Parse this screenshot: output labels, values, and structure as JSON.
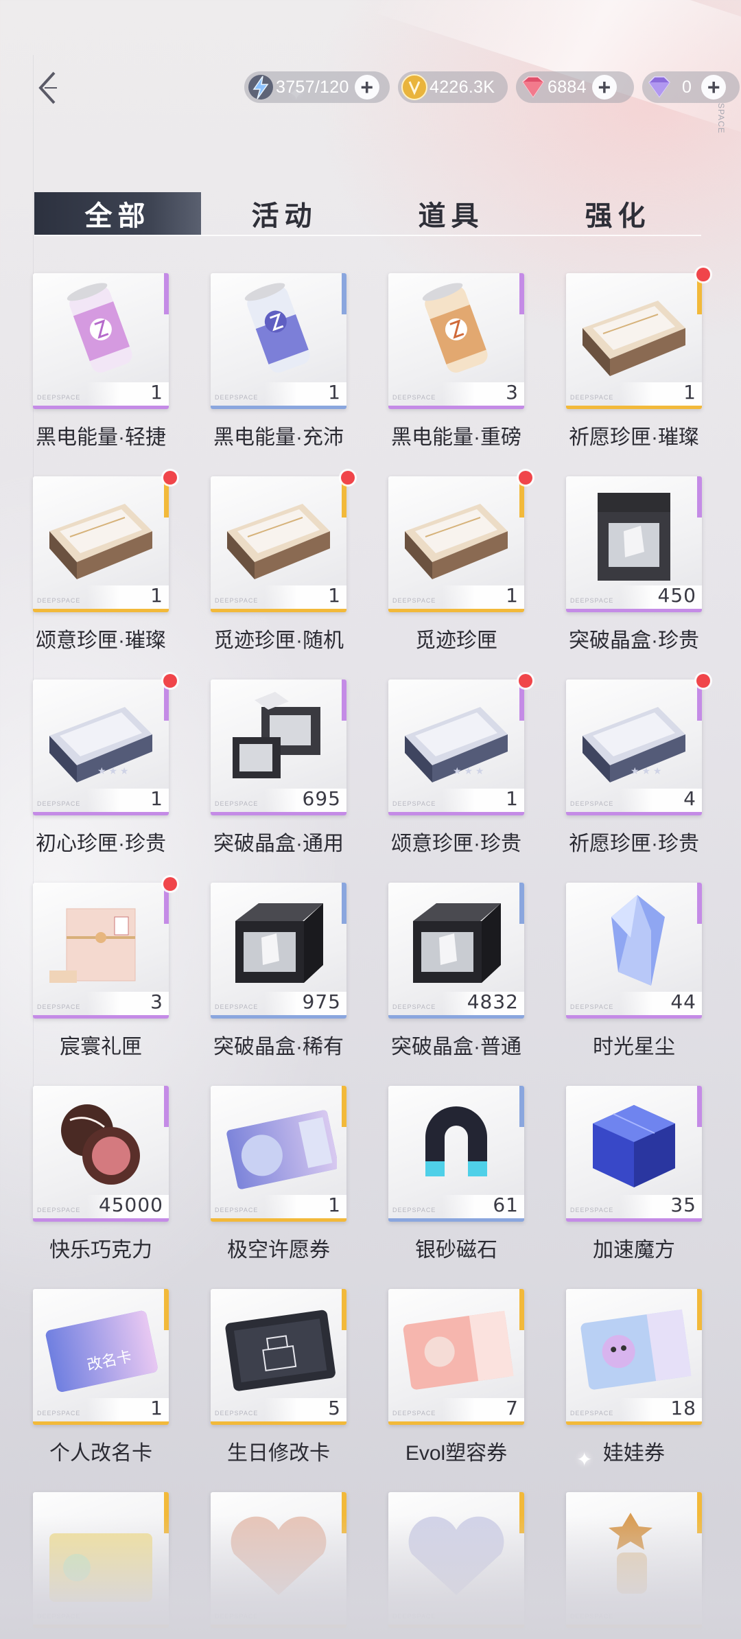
{
  "topbar": {
    "back_icon": "chevron-left-icon",
    "resources": [
      {
        "icon": "lightning-icon",
        "value": "3757/120",
        "color": "#6fa3e8"
      },
      {
        "icon": "gold-coin-icon",
        "value": "4226.3K",
        "color": "#e9b43c"
      },
      {
        "icon": "red-gem-icon",
        "value": "6884",
        "color": "#e0506a"
      },
      {
        "icon": "purple-diamond-icon",
        "value": "0",
        "color": "#8c6cdc"
      }
    ]
  },
  "tabs": [
    {
      "label": "全部",
      "active": true
    },
    {
      "label": "活动",
      "active": false
    },
    {
      "label": "道具",
      "active": false
    },
    {
      "label": "强化",
      "active": false
    }
  ],
  "colors": {
    "rarity_gold": "#f2b93a",
    "rarity_purple": "#c48be6",
    "rarity_blue": "#8aa6de",
    "notify_red": "#f0454a"
  },
  "items": [
    {
      "name": "黑电能量·轻捷",
      "count": "1",
      "rarity": "purple",
      "art": "can-purple",
      "dot": false
    },
    {
      "name": "黑电能量·充沛",
      "count": "1",
      "rarity": "blue",
      "art": "can-blue",
      "dot": false
    },
    {
      "name": "黑电能量·重磅",
      "count": "3",
      "rarity": "purple",
      "art": "can-gold",
      "dot": false
    },
    {
      "name": "祈愿珍匣·璀璨",
      "count": "1",
      "rarity": "gold",
      "art": "box-gold",
      "dot": true
    },
    {
      "name": "颂意珍匣·璀璨",
      "count": "1",
      "rarity": "gold",
      "art": "box-gold",
      "dot": true
    },
    {
      "name": "觅迹珍匣·随机",
      "count": "1",
      "rarity": "gold",
      "art": "box-gold",
      "dot": true
    },
    {
      "name": "觅迹珍匣",
      "count": "1",
      "rarity": "gold",
      "art": "box-gold",
      "dot": true
    },
    {
      "name": "突破晶盒·珍贵",
      "count": "450",
      "rarity": "purple",
      "art": "crate-dark",
      "dot": false
    },
    {
      "name": "初心珍匣·珍贵",
      "count": "1",
      "rarity": "purple",
      "art": "box-blue",
      "dot": true
    },
    {
      "name": "突破晶盒·通用",
      "count": "695",
      "rarity": "purple",
      "art": "crates-open",
      "dot": false
    },
    {
      "name": "颂意珍匣·珍贵",
      "count": "1",
      "rarity": "purple",
      "art": "box-blue",
      "dot": true
    },
    {
      "name": "祈愿珍匣·珍贵",
      "count": "4",
      "rarity": "purple",
      "art": "box-blue",
      "dot": true
    },
    {
      "name": "宸寰礼匣",
      "count": "3",
      "rarity": "purple",
      "art": "gift-box",
      "dot": true
    },
    {
      "name": "突破晶盒·稀有",
      "count": "975",
      "rarity": "blue",
      "art": "crate-black",
      "dot": false
    },
    {
      "name": "突破晶盒·普通",
      "count": "4832",
      "rarity": "blue",
      "art": "crate-black",
      "dot": false
    },
    {
      "name": "时光星尘",
      "count": "44",
      "rarity": "purple",
      "art": "crystal",
      "dot": false
    },
    {
      "name": "快乐巧克力",
      "count": "45000",
      "rarity": "purple",
      "art": "chocolate",
      "dot": false
    },
    {
      "name": "极空许愿券",
      "count": "1",
      "rarity": "gold",
      "art": "ticket-moon",
      "dot": false
    },
    {
      "name": "银砂磁石",
      "count": "61",
      "rarity": "blue",
      "art": "magnet",
      "dot": false
    },
    {
      "name": "加速魔方",
      "count": "35",
      "rarity": "purple",
      "art": "cube",
      "dot": false
    },
    {
      "name": "个人改名卡",
      "count": "1",
      "rarity": "gold",
      "art": "rename-card",
      "dot": false
    },
    {
      "name": "生日修改卡",
      "count": "5",
      "rarity": "gold",
      "art": "birthday-card",
      "dot": false
    },
    {
      "name": "Evol塑容券",
      "count": "7",
      "rarity": "gold",
      "art": "evol-ticket",
      "dot": false
    },
    {
      "name": "娃娃券",
      "count": "18",
      "rarity": "gold",
      "art": "doll-ticket",
      "dot": false
    },
    {
      "name": "",
      "count": "",
      "rarity": "gold",
      "art": "yellow-ticket",
      "dot": false
    },
    {
      "name": "",
      "count": "",
      "rarity": "gold",
      "art": "diamond-heart",
      "dot": false
    },
    {
      "name": "",
      "count": "",
      "rarity": "gold",
      "art": "diamond-heart-2",
      "dot": false
    },
    {
      "name": "",
      "count": "",
      "rarity": "gold",
      "art": "figurine",
      "dot": false
    }
  ]
}
